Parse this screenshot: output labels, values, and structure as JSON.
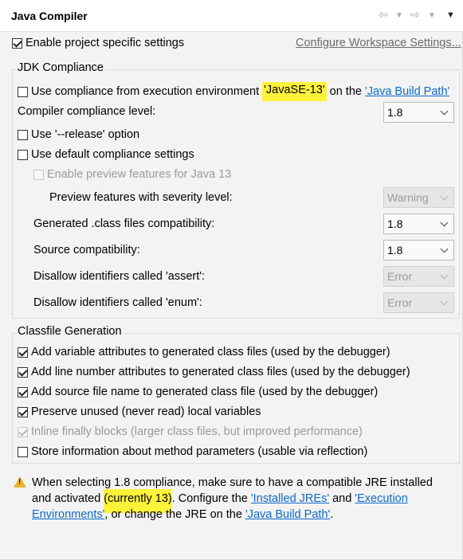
{
  "header": {
    "title": "Java Compiler",
    "nav_icons": [
      "back-arrow-icon",
      "dropdown-icon",
      "forward-arrow-icon",
      "dropdown-icon",
      "menu-icon"
    ]
  },
  "project_settings": {
    "enable_label": "Enable project specific settings",
    "enable_checked": true,
    "configure_link": "Configure Workspace Settings..."
  },
  "jdk": {
    "group_label": "JDK Compliance",
    "use_env_prefix": "Use compliance from execution environment ",
    "use_env_value": "'JavaSE-13'",
    "use_env_mid": " on the ",
    "use_env_link": "'Java Build Path'",
    "compliance_label": "Compiler compliance level:",
    "compliance_value": "1.8",
    "release_label": "Use '--release' option",
    "default_label": "Use default compliance settings",
    "preview_label": "Enable preview features for Java 13",
    "severity_label": "Preview features with severity level:",
    "severity_value": "Warning",
    "generated_label": "Generated .class files compatibility:",
    "generated_value": "1.8",
    "source_label": "Source compatibility:",
    "source_value": "1.8",
    "assert_label": "Disallow identifiers called 'assert':",
    "assert_value": "Error",
    "enum_label": "Disallow identifiers called 'enum':",
    "enum_value": "Error"
  },
  "classfile": {
    "group_label": "Classfile Generation",
    "items": [
      {
        "label": "Add variable attributes to generated class files (used by the debugger)",
        "checked": true,
        "disabled": false
      },
      {
        "label": "Add line number attributes to generated class files (used by the debugger)",
        "checked": true,
        "disabled": false
      },
      {
        "label": "Add source file name to generated class file (used by the debugger)",
        "checked": true,
        "disabled": false
      },
      {
        "label": "Preserve unused (never read) local variables",
        "checked": true,
        "disabled": false
      },
      {
        "label": "Inline finally blocks (larger class files, but improved performance)",
        "checked": true,
        "disabled": true
      },
      {
        "label": "Store information about method parameters (usable via reflection)",
        "checked": false,
        "disabled": false
      }
    ]
  },
  "warning": {
    "icon": "warning-icon",
    "line1": "When selecting 1.8 compliance, make sure to have a compatible JRE installed",
    "line2_prefix": "and activated ",
    "line2_highlight": "(currently 13)",
    "line2_mid": ". Configure the ",
    "installed_link": "'Installed JREs'",
    "and_text": " and ",
    "exec_link_1": "'Execution",
    "exec_link_2": "Environments'",
    "line3_mid": ", or change the JRE on the ",
    "build_path_link": "'Java Build Path'",
    "line3_end": "."
  },
  "colors": {
    "highlight": "#fff33a",
    "link": "#0e69c8",
    "warning": "#e9b32f"
  }
}
